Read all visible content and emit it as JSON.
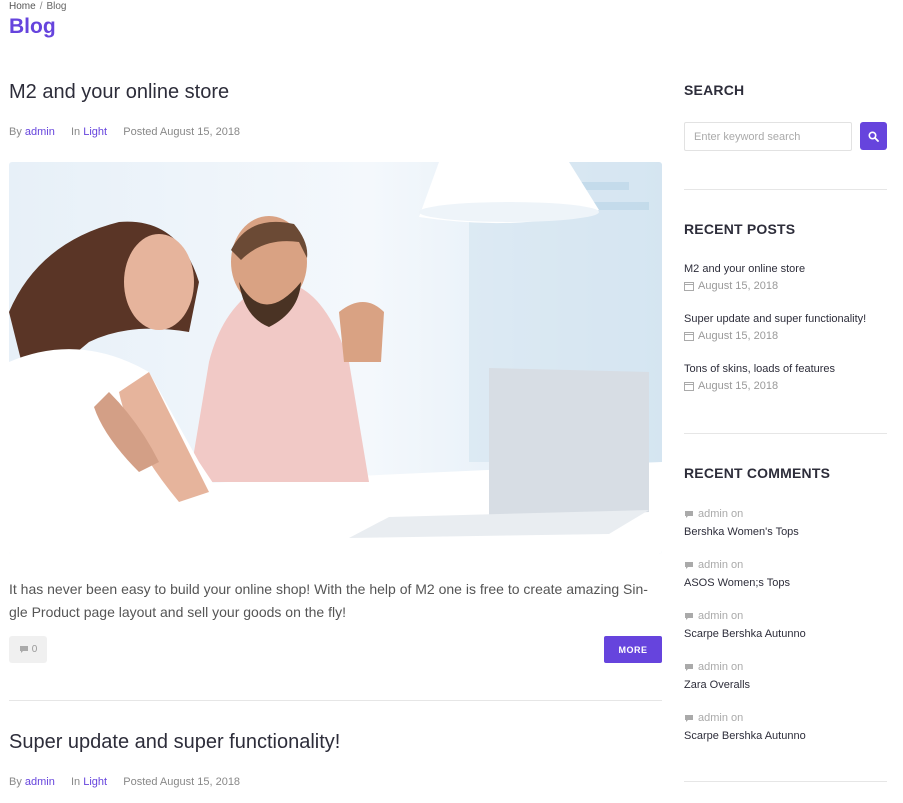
{
  "breadcrumb": {
    "home": "Home",
    "separator": "/",
    "current": "Blog"
  },
  "page": {
    "title": "Blog"
  },
  "colors": {
    "accent": "#6644dd",
    "text": "#2d2d3a",
    "muted": "#888888",
    "divider": "#e6e6e6"
  },
  "posts": [
    {
      "title": "M2 and your online store",
      "by_label": "By",
      "author": "admin",
      "in_label": "In",
      "category": "Light",
      "posted": "Posted August 15, 2018",
      "excerpt": "It has never been easy to build your online shop! With the help of M2 one is free to create amazing Sin-gle Product page layout and sell your goods on the fly!",
      "comments": "0",
      "more_label": "MORE"
    },
    {
      "title": "Super update and super functionality!",
      "by_label": "By",
      "author": "admin",
      "in_label": "In",
      "category": "Light",
      "posted": "Posted August 15, 2018"
    }
  ],
  "sidebar": {
    "search": {
      "title": "SEARCH",
      "placeholder": "Enter keyword search",
      "button_icon": "search-icon"
    },
    "recent_posts": {
      "title": "RECENT POSTS",
      "items": [
        {
          "title": "M2 and your online store",
          "date": "August 15, 2018"
        },
        {
          "title": "Super update and super functionality!",
          "date": "August 15, 2018"
        },
        {
          "title": "Tons of skins, loads of features",
          "date": "August 15, 2018"
        }
      ]
    },
    "recent_comments": {
      "title": "RECENT COMMENTS",
      "items": [
        {
          "author": "admin on",
          "post": "Bershka Women's Tops"
        },
        {
          "author": "admin on",
          "post": "ASOS Women;s Tops"
        },
        {
          "author": "admin on",
          "post": "Scarpe Bershka Autunno"
        },
        {
          "author": "admin on",
          "post": "Zara Overalls"
        },
        {
          "author": "admin on",
          "post": "Scarpe Bershka Autunno"
        }
      ]
    }
  }
}
